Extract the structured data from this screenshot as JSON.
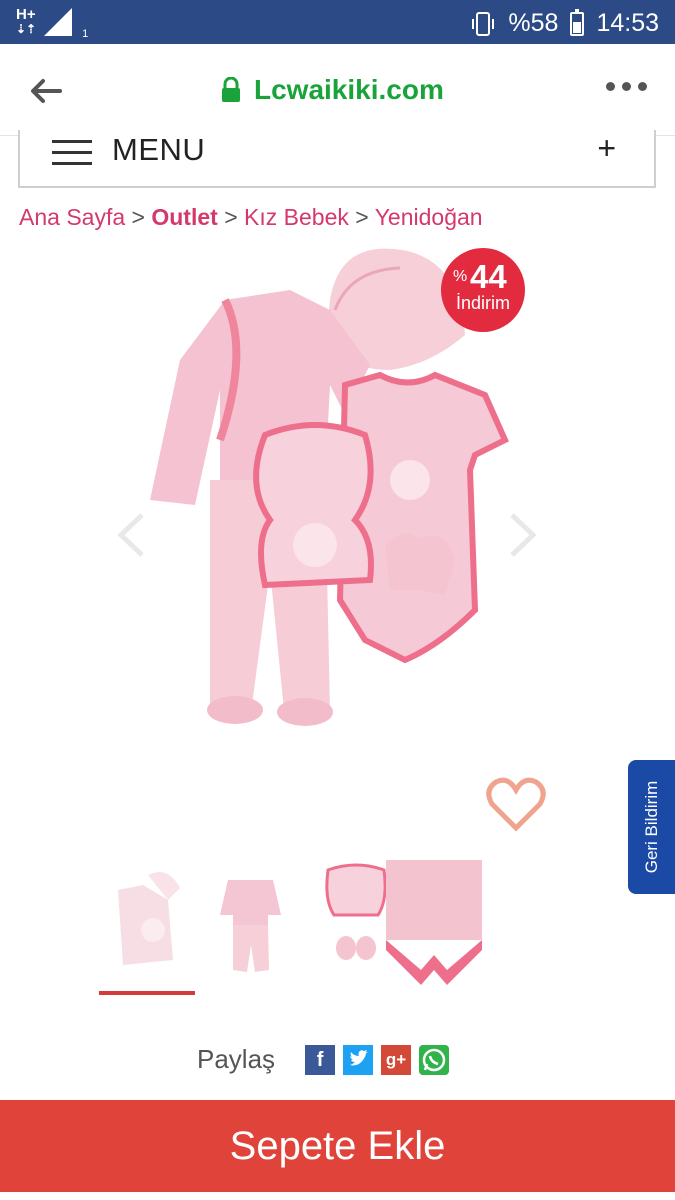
{
  "status_bar": {
    "network": "H+",
    "sim_number": "1",
    "battery_percent": "%58",
    "time": "14:53"
  },
  "browser": {
    "domain": "Lcwaikiki.com",
    "icons": {
      "back": "back-arrow-icon",
      "lock": "lock-icon",
      "more": "more-vert-icon"
    }
  },
  "menu": {
    "label": "MENU",
    "expand_symbol": "+"
  },
  "breadcrumb": {
    "items": [
      "Ana Sayfa",
      "Outlet",
      "Kız Bebek",
      "Yenidoğan"
    ],
    "separator": ">"
  },
  "product": {
    "discount": {
      "symbol": "%",
      "value": "44",
      "label": "İndirim"
    },
    "gallery_index": 0
  },
  "feedback_tab": {
    "label": "Geri Bildirim"
  },
  "share": {
    "label": "Paylaş"
  },
  "cart_button": {
    "label": "Sepete Ekle"
  },
  "colors": {
    "status_bar": "#2c4a86",
    "brand_green": "#19a33a",
    "breadcrumb": "#d4396b",
    "discount_badge": "#e32b3f",
    "cart_button": "#e0433a",
    "feedback_tab": "#1a4aa6"
  }
}
